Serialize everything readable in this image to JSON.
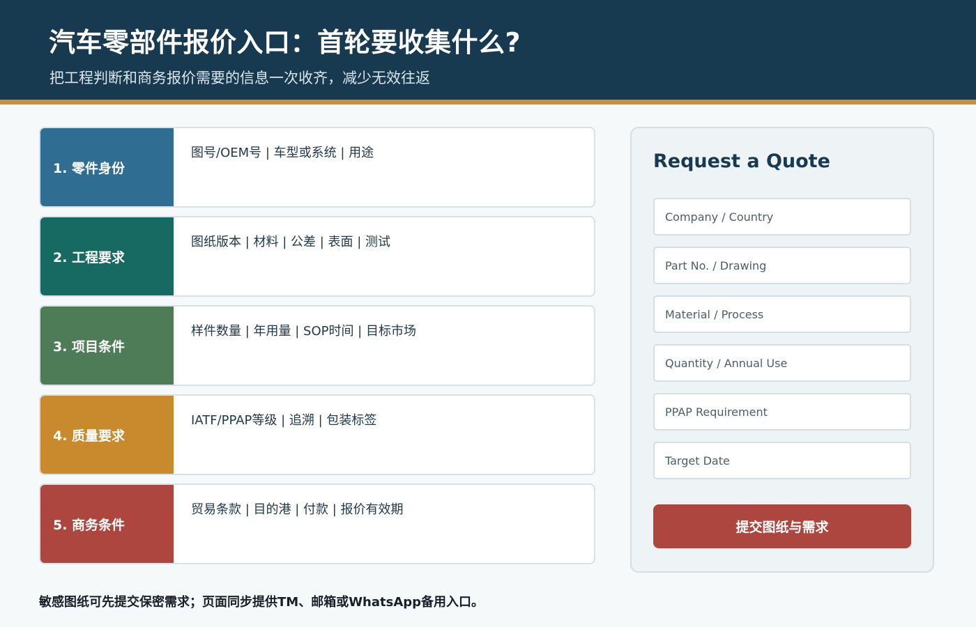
{
  "header": {
    "title": "汽车零部件报价入口：首轮要收集什么?",
    "subtitle": "把工程判断和商务报价需要的信息一次收齐，减少无效往返"
  },
  "steps": [
    {
      "label": "1. 零件身份",
      "detail": "图号/OEM号 | 车型或系统 | 用途",
      "color": "#2f6d93"
    },
    {
      "label": "2. 工程要求",
      "detail": "图纸版本 | 材料 | 公差 | 表面 | 测试",
      "color": "#166a62"
    },
    {
      "label": "3. 项目条件",
      "detail": "样件数量 | 年用量 | SOP时间 | 目标市场",
      "color": "#4d7c56"
    },
    {
      "label": "4. 质量要求",
      "detail": "IATF/PPAP等级 | 追溯 | 包装标签",
      "color": "#c88a2c"
    },
    {
      "label": "5. 商务条件",
      "detail": "贸易条款 | 目的港 | 付款 | 报价有效期",
      "color": "#ad463f"
    }
  ],
  "quote_form": {
    "title": "Request a Quote",
    "fields": [
      {
        "placeholder": "Company / Country",
        "value": ""
      },
      {
        "placeholder": "Part No. / Drawing",
        "value": ""
      },
      {
        "placeholder": "Material / Process",
        "value": ""
      },
      {
        "placeholder": "Quantity / Annual Use",
        "value": ""
      },
      {
        "placeholder": "PPAP Requirement",
        "value": ""
      },
      {
        "placeholder": "Target Date",
        "value": ""
      }
    ],
    "submit_label": "提交图纸与需求"
  },
  "footer": {
    "note": "敏感图纸可先提交保密需求；页面同步提供TM、邮箱或WhatsApp备用入口。"
  },
  "colors": {
    "header_bg": "#183a50",
    "accent_stripe": "#cc9134",
    "submit_button": "#ad463f"
  }
}
